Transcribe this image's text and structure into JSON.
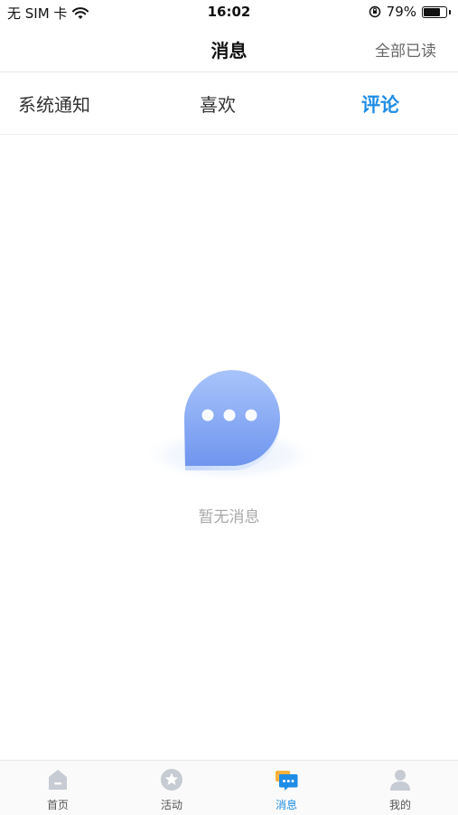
{
  "status_bar": {
    "carrier": "无 SIM 卡",
    "time": "16:02",
    "battery_percent": "79%",
    "battery_level": 0.79
  },
  "nav": {
    "title": "消息",
    "action": "全部已读"
  },
  "tabs": [
    {
      "label": "系统通知",
      "active": false
    },
    {
      "label": "喜欢",
      "active": false
    },
    {
      "label": "评论",
      "active": true
    }
  ],
  "empty_state": {
    "text": "暂无消息",
    "icon": "chat-bubble-icon"
  },
  "bottom_tabs": [
    {
      "label": "首页",
      "icon": "home-icon",
      "active": false
    },
    {
      "label": "活动",
      "icon": "star-icon",
      "active": false
    },
    {
      "label": "消息",
      "icon": "message-icon",
      "active": true
    },
    {
      "label": "我的",
      "icon": "user-icon",
      "active": false
    }
  ],
  "colors": {
    "accent": "#1f8de6",
    "inactive_icon": "#c7cbd3"
  }
}
